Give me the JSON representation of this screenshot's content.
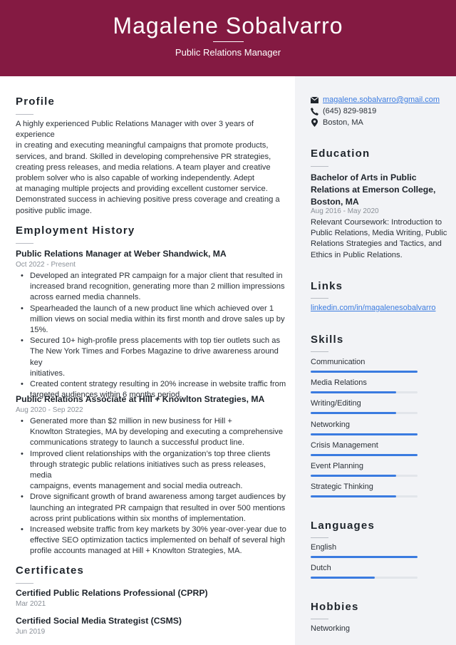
{
  "header": {
    "name": "Magalene Sobalvarro",
    "title": "Public Relations Manager",
    "background_color": "#841a42"
  },
  "profile": {
    "heading": "Profile",
    "lines": [
      "A highly experienced Public Relations Manager with over 3 years of experience",
      "in creating and executing meaningful campaigns that promote products,",
      "services, and brand. Skilled in developing comprehensive PR strategies,",
      "creating press releases, and media relations. A team player and creative",
      "problem solver who is also capable of working independently. Adept",
      "at managing multiple projects and providing excellent customer service.",
      "Demonstrated success in achieving positive press coverage and creating a",
      "positive public image."
    ]
  },
  "employment": {
    "heading": "Employment History",
    "jobs": [
      {
        "title": "Public Relations Manager at Weber Shandwick, MA",
        "dates": "Oct 2022 - Present",
        "bullets": [
          [
            "Developed an integrated PR campaign for a major client that resulted in",
            "increased brand recognition, generating more than 2 million impressions",
            "across earned media channels."
          ],
          [
            "Spearheaded the launch of a new product line which achieved over 1",
            "million views on social media within its first month and drove sales up by",
            "15%."
          ],
          [
            "Secured 10+ high-profile press placements with top tier outlets such as",
            "The New York Times and Forbes Magazine to drive awareness around key",
            "initiatives."
          ],
          [
            "Created content strategy resulting in 20% increase in website traffic from",
            "targeted audiences within 6 months period."
          ]
        ]
      },
      {
        "title": "Public Relations Associate at Hill + Knowlton Strategies, MA",
        "dates": "Aug 2020 - Sep 2022",
        "bullets": [
          [
            "Generated more than $2 million in new business for Hill +",
            "Knowlton Strategies, MA by developing and executing a comprehensive",
            "communications strategy to launch a successful product line."
          ],
          [
            "Improved client relationships with the organization’s top three clients",
            "through strategic public relations initiatives such as press releases, media",
            "campaigns, events management and social media outreach."
          ],
          [
            "Drove significant growth of brand awareness among target audiences by",
            "launching an integrated PR campaign that resulted in over 500 mentions",
            "across print publications within six months of implementation."
          ],
          [
            "Increased website traffic from key markets by 30% year-over-year due to",
            "effective SEO optimization tactics implemented on behalf of several high",
            "profile accounts managed at Hill + Knowlton Strategies, MA."
          ]
        ]
      }
    ]
  },
  "certificates": {
    "heading": "Certificates",
    "items": [
      {
        "name": "Certified Public Relations Professional (CPRP)",
        "date": "Mar 2021"
      },
      {
        "name": "Certified Social Media Strategist (CSMS)",
        "date": "Jun 2019"
      }
    ]
  },
  "contact": {
    "email": "magalene.sobalvarro@gmail.com",
    "phone": "(645) 829-9819",
    "location": "Boston, MA",
    "icons": [
      "envelope-icon",
      "phone-icon",
      "map-pin-icon"
    ]
  },
  "education": {
    "heading": "Education",
    "degree_lines": [
      "Bachelor of Arts in Public",
      "Relations at Emerson College,",
      "Boston, MA"
    ],
    "dates": "Aug 2016 - May 2020",
    "description_lines": [
      "Relevant Coursework: Introduction to",
      "Public Relations, Media Writing, Public",
      "Relations Strategies and Tactics, and",
      "Ethics in Public Relations."
    ]
  },
  "links": {
    "heading": "Links",
    "items": [
      "linkedin.com/in/magalenesobalvarro"
    ]
  },
  "skills": {
    "heading": "Skills",
    "accent_color": "#3a7be0",
    "items": [
      {
        "name": "Communication",
        "level": 100
      },
      {
        "name": "Media Relations",
        "level": 80
      },
      {
        "name": "Writing/Editing",
        "level": 80
      },
      {
        "name": "Networking",
        "level": 100
      },
      {
        "name": "Crisis Management",
        "level": 100
      },
      {
        "name": "Event Planning",
        "level": 80
      },
      {
        "name": "Strategic Thinking",
        "level": 80
      }
    ]
  },
  "languages": {
    "heading": "Languages",
    "items": [
      {
        "name": "English",
        "level": 100
      },
      {
        "name": "Dutch",
        "level": 60
      }
    ]
  },
  "hobbies": {
    "heading": "Hobbies",
    "items": [
      "Networking"
    ]
  }
}
